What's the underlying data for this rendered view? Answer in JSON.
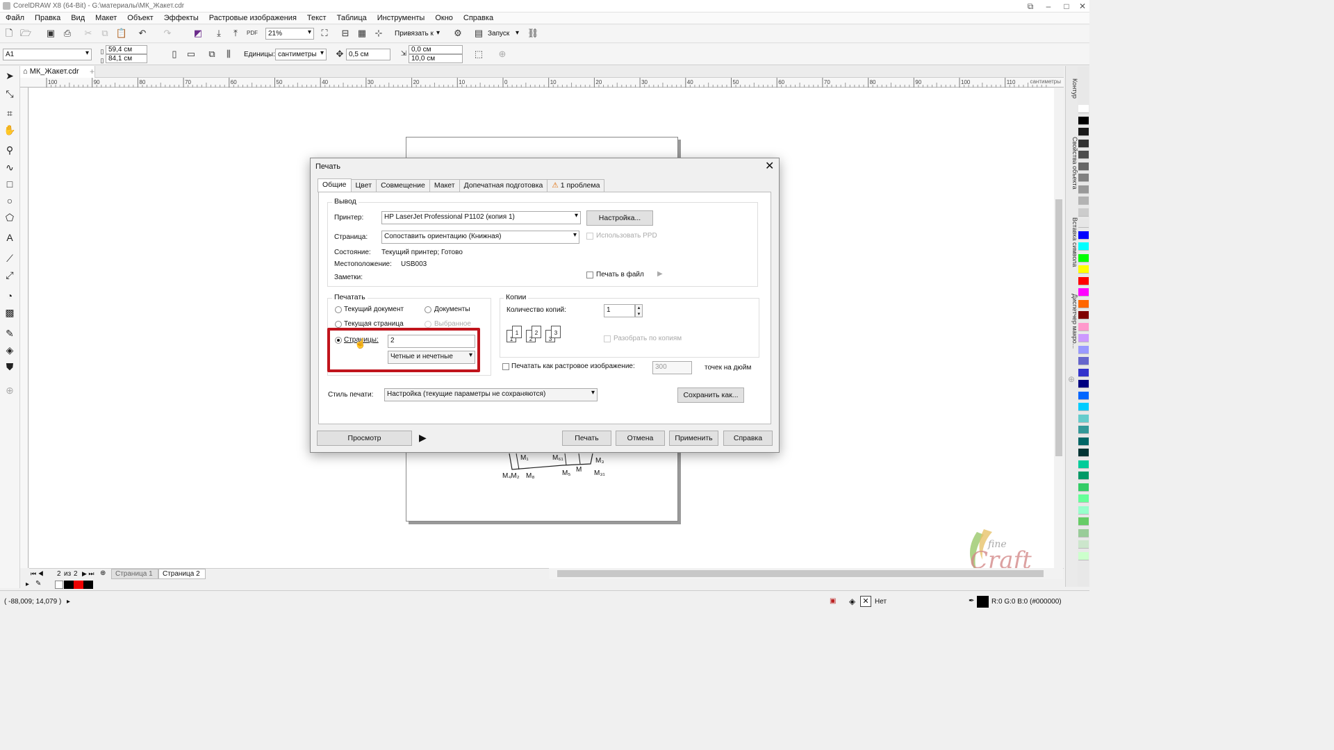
{
  "window": {
    "title": "CorelDRAW X8 (64-Bit) - G:\\материалы\\МК_Жакет.cdr"
  },
  "menu": [
    "Файл",
    "Правка",
    "Вид",
    "Макет",
    "Объект",
    "Эффекты",
    "Растровые изображения",
    "Текст",
    "Таблица",
    "Инструменты",
    "Окно",
    "Справка"
  ],
  "toolbar": {
    "zoom": "21%",
    "snap_label": "Привязать к",
    "launch_label": "Запуск"
  },
  "propbar": {
    "page_size": "A1",
    "width": "59,4 см",
    "height": "84,1 см",
    "units_label": "Единицы:",
    "units_value": "сантиметры",
    "nudge": "0,5 см",
    "dup_x": "0,0 см",
    "dup_y": "10,0 см"
  },
  "document_tab": "МК_Жакет.cdr",
  "ruler": {
    "labels": [
      "100",
      "90",
      "80",
      "70",
      "60",
      "50",
      "40",
      "30",
      "20",
      "10",
      "0",
      "10",
      "20",
      "30",
      "40",
      "50",
      "60",
      "70",
      "80",
      "90",
      "100",
      "110"
    ],
    "unit": "сантиметры"
  },
  "pages": {
    "current": "2",
    "of_label": "из",
    "total": "2",
    "tabs": [
      "Страница 1",
      "Страница 2"
    ]
  },
  "dockers": [
    "Контур",
    "Свойства объекта",
    "Вставка символа",
    "Диспетчер макро..."
  ],
  "palette_colors": [
    "#ffffff",
    "#000000",
    "#1a1a1a",
    "#333333",
    "#4d4d4d",
    "#666666",
    "#808080",
    "#999999",
    "#b3b3b3",
    "#cccccc",
    "#e6e6e6",
    "#0000ff",
    "#00ffff",
    "#00ff00",
    "#ffff00",
    "#ff0000",
    "#ff00ff",
    "#ff6600",
    "#800000",
    "#ff99cc",
    "#cc99ff",
    "#9999ff",
    "#6666cc",
    "#3333cc",
    "#000080",
    "#0066ff",
    "#00ccff",
    "#66cccc",
    "#339999",
    "#006666",
    "#003333",
    "#00cc99",
    "#009966",
    "#33cc66",
    "#66ff99",
    "#99ffcc",
    "#66cc66",
    "#99cc99",
    "#cce6cc",
    "#ccffcc"
  ],
  "status": {
    "coords": "( -88,009; 14,079 )",
    "fill_label": "Нет",
    "color_info": "R:0 G:0 B:0 (#000000)"
  },
  "drawing_labels": [
    "M₁",
    "M₆₁",
    "M₃",
    "M₄M₂",
    "M₈",
    "M₅",
    "M",
    "M₃₁"
  ],
  "dialog": {
    "title": "Печать",
    "tabs": [
      "Общие",
      "Цвет",
      "Совмещение",
      "Макет",
      "Допечатная подготовка",
      "1 проблема"
    ],
    "output": {
      "group_label": "Вывод",
      "printer_label": "Принтер:",
      "printer_value": "HP LaserJet Professional P1102 (копия 1)",
      "setup_button": "Настройка...",
      "page_label": "Страница:",
      "page_value": "Сопоставить ориентацию (Книжная)",
      "use_ppd": "Использовать PPD",
      "state_label": "Состояние:",
      "state_value": "Текущий принтер; Готово",
      "location_label": "Местоположение:",
      "location_value": "USB003",
      "notes_label": "Заметки:",
      "print_to_file": "Печать в файл"
    },
    "print_range": {
      "group_label": "Печатать",
      "current_document": "Текущий документ",
      "documents": "Документы",
      "current_page": "Текущая страница",
      "selection": "Выбранное",
      "pages_label": "Страницы:",
      "pages_value": "2",
      "even_odd": "Четные и нечетные"
    },
    "copies": {
      "group_label": "Копии",
      "count_label": "Количество копий:",
      "count_value": "1",
      "collate": "Разобрать по копиям"
    },
    "raster": {
      "label": "Печатать как растровое изображение:",
      "dpi_value": "300",
      "dpi_label": "точек на дюйм"
    },
    "style": {
      "label": "Стиль печати:",
      "value": "Настройка (текущие параметры не сохраняются)",
      "save_button": "Сохранить как..."
    },
    "buttons": {
      "preview": "Просмотр",
      "print": "Печать",
      "cancel": "Отмена",
      "apply": "Применить",
      "help": "Справка"
    }
  }
}
